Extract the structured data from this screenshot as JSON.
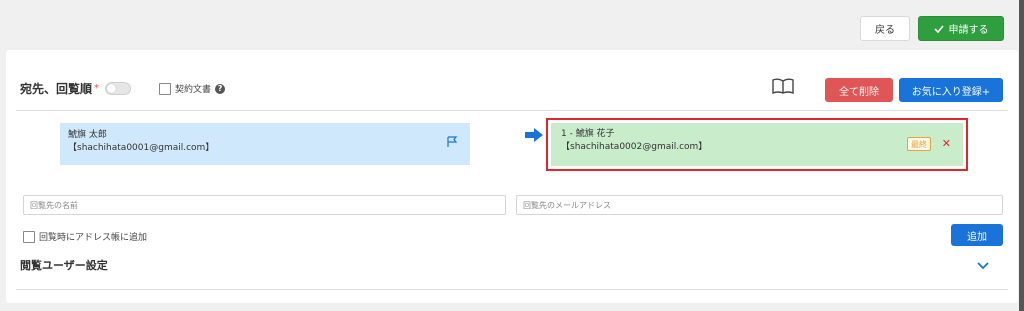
{
  "topbar": {
    "back_label": "戻る",
    "apply_label": "申請する"
  },
  "destination": {
    "title": "宛先、回覧順",
    "required_mark": "*",
    "contract_label": "契約文書",
    "delete_all_label": "全て削除",
    "favorite_label": "お気に入り登録+"
  },
  "sender": {
    "name": "鯱旗 太郎",
    "email": "【shachihata0001@gmail.com】"
  },
  "recipient": {
    "name": "1 - 鯱旗 花子",
    "email": "【shachihata0002@gmail.com】",
    "badge": "最終"
  },
  "form": {
    "name_placeholder": "回覧先の名前",
    "email_placeholder": "回覧先のメールアドレス",
    "addrbook_label": "回覧時にアドレス帳に追加",
    "add_label": "追加"
  },
  "viewer": {
    "title": "閲覧ユーザー設定"
  },
  "colors": {
    "apply": "#2e9e3e",
    "primary": "#1a73d9",
    "danger": "#e05555",
    "highlight_border": "#e0262e"
  }
}
